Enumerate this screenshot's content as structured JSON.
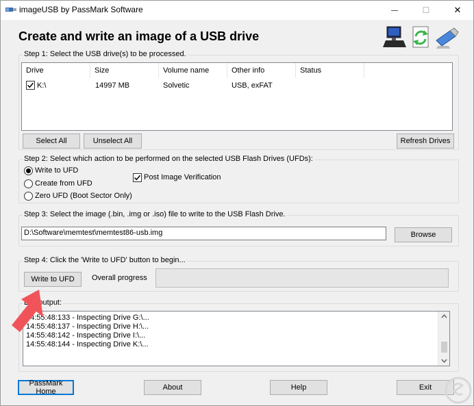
{
  "window": {
    "title": "imageUSB by PassMark Software",
    "minimize_glyph": "—",
    "maximize_glyph": "☐",
    "close_glyph": "✕"
  },
  "heading": "Create and write an image of a USB drive",
  "step1": {
    "legend": "Step 1: Select the USB drive(s) to be processed.",
    "columns": [
      "Drive",
      "Size",
      "Volume name",
      "Other info",
      "Status"
    ],
    "drives": [
      {
        "checked": true,
        "drive": "K:\\",
        "size": "14997 MB",
        "volume": "Solvetic",
        "info": "USB, exFAT",
        "status": ""
      }
    ],
    "select_all": "Select All",
    "unselect_all": "Unselect All",
    "refresh": "Refresh Drives"
  },
  "step2": {
    "legend": "Step 2: Select which action to be performed on the selected USB Flash Drives (UFDs):",
    "options": [
      {
        "label": "Write to UFD",
        "checked": true
      },
      {
        "label": "Create from UFD",
        "checked": false
      },
      {
        "label": "Zero UFD (Boot Sector Only)",
        "checked": false
      }
    ],
    "verify_label": "Post Image Verification",
    "verify_checked": true
  },
  "step3": {
    "legend": "Step 3: Select the image (.bin, .img or .iso) file to write to the USB Flash Drive.",
    "path": "D:\\Software\\memtest\\memtest86-usb.img",
    "browse": "Browse"
  },
  "step4": {
    "legend": "Step 4: Click the 'Write to UFD' button to begin...",
    "write_button": "Write to UFD",
    "progress_label": "Overall progress",
    "progress": 0
  },
  "log": {
    "legend": "Log output:",
    "lines": [
      "14:55:48:133 - Inspecting Drive G:\\...",
      "14:55:48:137 - Inspecting Drive H:\\...",
      "14:55:48:142 - Inspecting Drive I:\\...",
      "14:55:48:144 - Inspecting Drive K:\\..."
    ]
  },
  "footer": {
    "home": "PassMark Home",
    "about": "About",
    "help": "Help",
    "exit": "Exit"
  },
  "colors": {
    "accent": "#0078d7",
    "annotation_arrow": "#f0545a",
    "window_bg": "#f0f0f0"
  },
  "icons": {
    "header": [
      "computer-icon",
      "refresh-document-icon",
      "usb-drive-icon"
    ],
    "annotation": "red-arrow-icon",
    "watermark": "watermark-logo"
  }
}
